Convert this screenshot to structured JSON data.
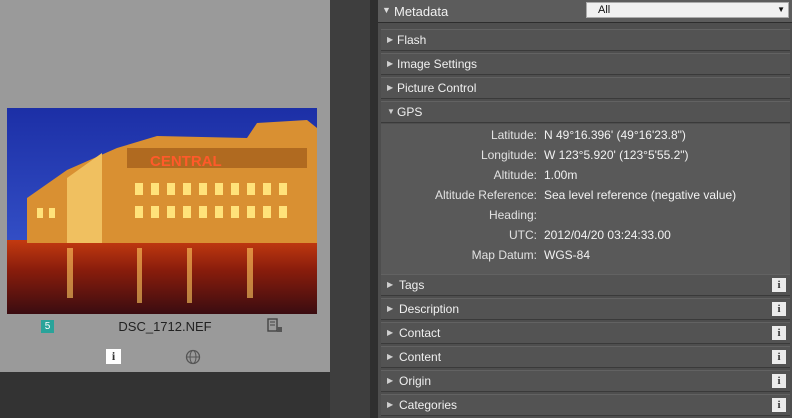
{
  "thumbnail": {
    "rating": "5",
    "file_name": "DSC_1712.NEF",
    "building_sign": "CENTRAL",
    "icons": [
      "edit-icon",
      "info-icon",
      "globe-icon"
    ]
  },
  "metadata": {
    "title": "Metadata",
    "filter_value": "All",
    "sections": [
      {
        "label": "Flash"
      },
      {
        "label": "Image Settings"
      },
      {
        "label": "Picture Control"
      }
    ],
    "gps": {
      "label": "GPS",
      "fields": [
        {
          "key": "Latitude:",
          "value": "N 49°16.396' (49°16'23.8\")"
        },
        {
          "key": "Longitude:",
          "value": "W 123°5.920' (123°5'55.2\")"
        },
        {
          "key": "Altitude:",
          "value": "1.00m"
        },
        {
          "key": "Altitude Reference:",
          "value": "Sea level reference (negative value)"
        },
        {
          "key": "Heading:",
          "value": ""
        },
        {
          "key": "UTC:",
          "value": "2012/04/20 03:24:33.00"
        },
        {
          "key": "Map Datum:",
          "value": "WGS-84"
        }
      ]
    },
    "iptc_sections": [
      {
        "label": "Tags"
      },
      {
        "label": "Description"
      },
      {
        "label": "Contact"
      },
      {
        "label": "Content"
      },
      {
        "label": "Origin"
      },
      {
        "label": "Categories"
      }
    ],
    "info_badge_text": "i"
  },
  "colors": {
    "panel": "#4e4e4e",
    "thumb_bg": "#9a9a9a",
    "rating_badge": "#2aa39a"
  }
}
